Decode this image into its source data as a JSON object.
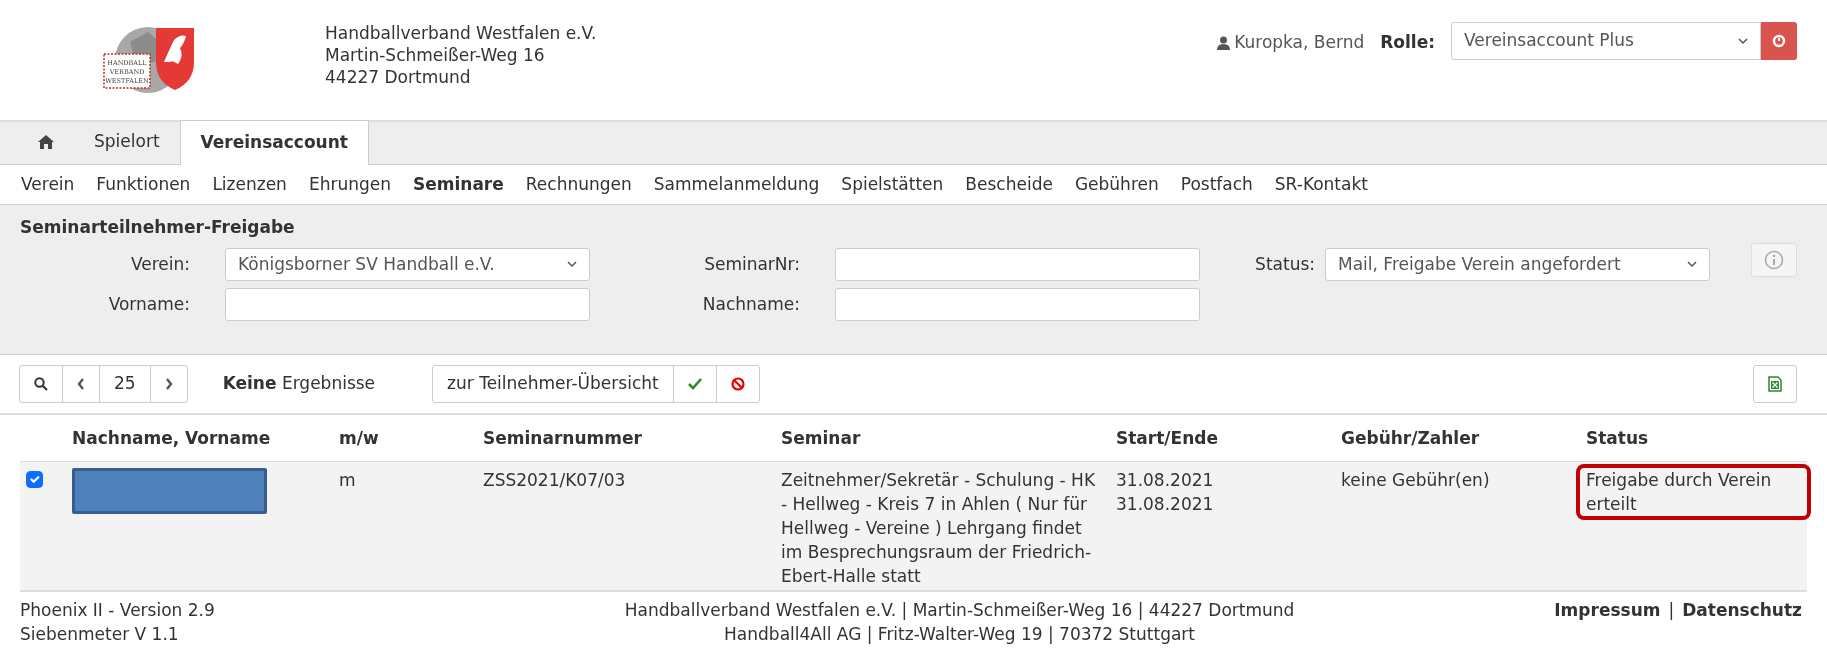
{
  "header": {
    "logo_text": [
      "HANDBALL",
      "VERBAND",
      "WESTFALEN"
    ],
    "org_lines": [
      "Handballverband Westfalen e.V.",
      "Martin-Schmeißer-Weg 16",
      "44227 Dortmund"
    ],
    "user": "Kuropka, Bernd",
    "role_label": "Rolle:",
    "role_value": "Vereinsaccount Plus"
  },
  "tabs": [
    {
      "kind": "home",
      "selected": false
    },
    {
      "kind": "text",
      "label": "Spielort",
      "selected": false
    },
    {
      "kind": "text",
      "label": "Vereinsaccount",
      "selected": true
    }
  ],
  "menu": [
    {
      "label": "Verein",
      "selected": false
    },
    {
      "label": "Funktionen",
      "selected": false
    },
    {
      "label": "Lizenzen",
      "selected": false
    },
    {
      "label": "Ehrungen",
      "selected": false
    },
    {
      "label": "Seminare",
      "selected": true
    },
    {
      "label": "Rechnungen",
      "selected": false
    },
    {
      "label": "Sammelanmeldung",
      "selected": false
    },
    {
      "label": "Spielstätten",
      "selected": false
    },
    {
      "label": "Bescheide",
      "selected": false
    },
    {
      "label": "Gebühren",
      "selected": false
    },
    {
      "label": "Postfach",
      "selected": false
    },
    {
      "label": "SR-Kontakt",
      "selected": false
    }
  ],
  "filter": {
    "title": "Seminarteilnehmer-Freigabe",
    "rows": [
      [
        {
          "label": "Verein:",
          "kind": "select",
          "value": "Königsborner SV Handball e.V."
        },
        {
          "label": "SeminarNr:",
          "kind": "input"
        },
        {
          "label": "Status:",
          "kind": "select",
          "value": "Mail, Freigabe Verein angefordert"
        }
      ],
      [
        {
          "label": "Vorname:",
          "kind": "input"
        },
        {
          "label": "Nachname:",
          "kind": "input"
        }
      ]
    ]
  },
  "toolbar": {
    "page_size": "25",
    "result": "**Keine** Ergebnisse",
    "overview_button": "zur Teilnehmer-Übersicht"
  },
  "table": {
    "columns": [
      "Nachname, Vorname",
      "m/w",
      "Seminarnummer",
      "Seminar",
      "Start/Ende",
      "Gebühr/Zahler",
      "Status"
    ],
    "rows": [
      {
        "checked": true,
        "name_redacted": true,
        "gender": "m",
        "seminar_number": "ZSS2021/K07/03",
        "seminar": "Zeitnehmer/Sekretär - Schulung - HK - Hellweg - Kreis 7 in Ahlen ( Nur für Hellweg - Vereine ) Lehrgang findet im Besprechungsraum der Friedrich-Ebert-Halle statt",
        "start": "31.08.2021",
        "end": "31.08.2021",
        "fee": "keine Gebühr(en)",
        "status": "Freigabe durch Verein erteilt",
        "highlighted": true
      }
    ]
  },
  "footer": {
    "left": [
      "Phoenix II - Version 2.9",
      "Siebenmeter V 1.1"
    ],
    "center": [
      "Handballverband Westfalen e.V. | Martin-Schmeißer-Weg 16 | 44227 Dortmund",
      "Handball4All AG | Fritz-Walter-Weg 19 | 70372 Stuttgart"
    ],
    "links": [
      "Impressum",
      "Datenschutz"
    ],
    "separator": "|"
  }
}
